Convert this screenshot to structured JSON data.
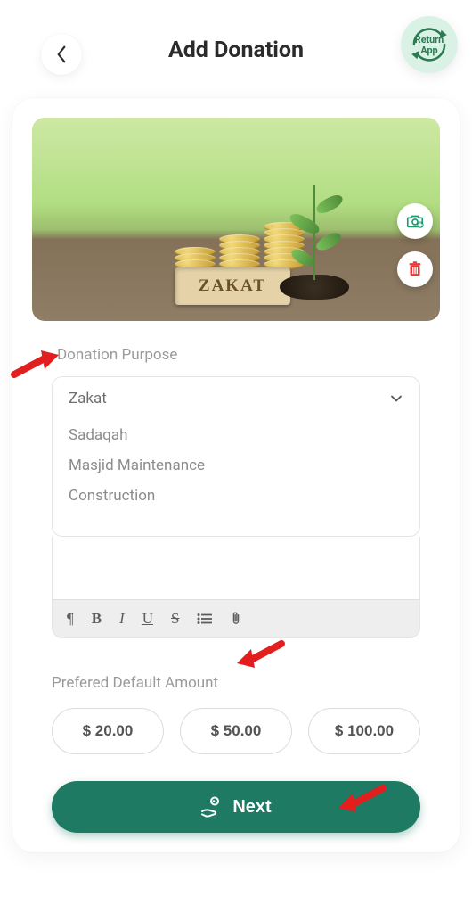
{
  "header": {
    "title": "Add Donation",
    "return_label_1": "Return",
    "return_label_2": "App"
  },
  "hero": {
    "plaque_text": "ZAKAT"
  },
  "form": {
    "purpose_label": "Donation Purpose",
    "purpose_selected": "Zakat",
    "purpose_options": [
      "Sadaqah",
      "Masjid Maintenance",
      "Construction"
    ]
  },
  "toolbar": {
    "pilcrow": "¶",
    "bold": "B",
    "italic": "I",
    "underline": "U",
    "strike": "S"
  },
  "amounts": {
    "label": "Prefered Default Amount",
    "options": [
      "$ 20.00",
      "$ 50.00",
      "$ 100.00"
    ]
  },
  "next": {
    "label": "Next"
  }
}
